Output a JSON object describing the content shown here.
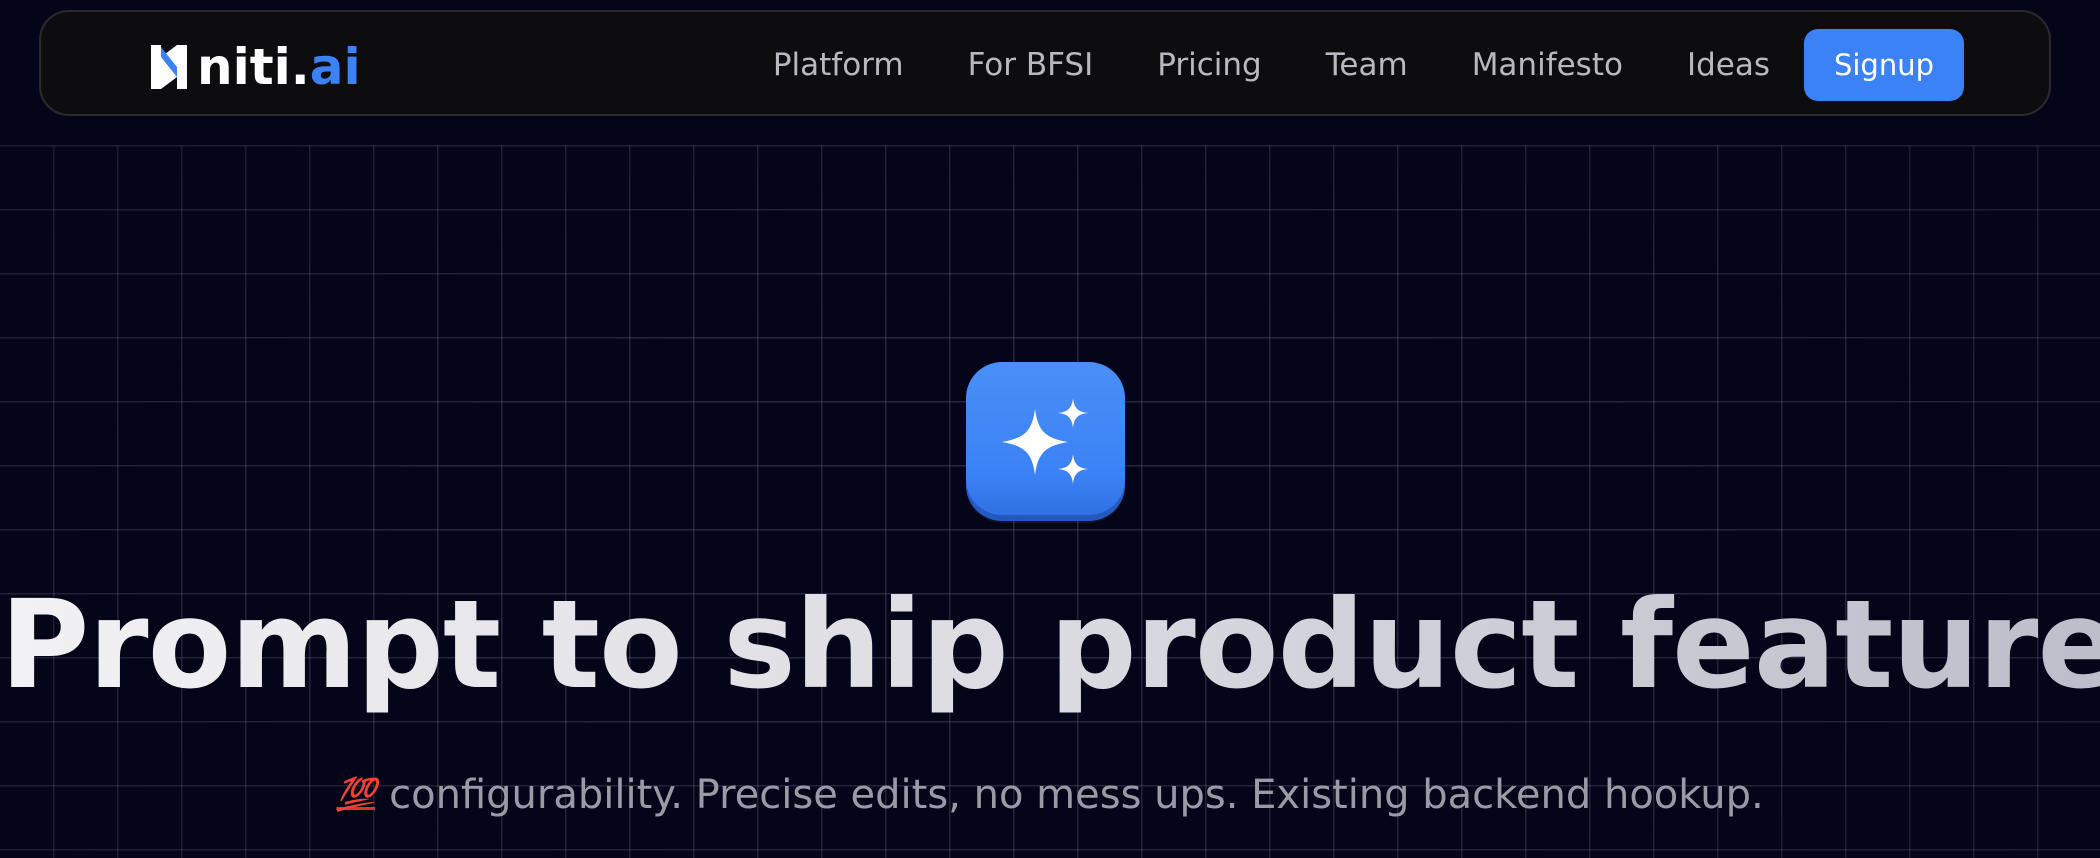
{
  "brand": {
    "logo_name": "niti",
    "logo_dot": ".",
    "logo_suffix": "ai",
    "accent_color": "#3b82f6"
  },
  "nav": {
    "items": [
      {
        "label": "Platform"
      },
      {
        "label": "For BFSI"
      },
      {
        "label": "Pricing"
      },
      {
        "label": "Team"
      },
      {
        "label": "Manifesto"
      },
      {
        "label": "Ideas"
      }
    ],
    "signup_label": "Signup"
  },
  "hero": {
    "icon": "sparkles-icon",
    "headline": "Prompt to ship product features",
    "headline_emoji": "ship-icon",
    "subline_emoji": "💯",
    "subline": "configurability. Precise edits, no mess ups. Existing backend hookup."
  },
  "colors": {
    "background": "#05051a",
    "navbar_bg": "#0d0d10",
    "nav_text": "#b8b8bf",
    "button": "#3b82f6"
  }
}
